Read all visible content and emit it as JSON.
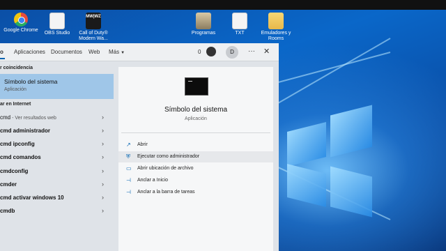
{
  "desktop": {
    "icons": [
      {
        "label": "Google Chrome",
        "icon": "chrome-icon"
      },
      {
        "label": "OBS Studio",
        "icon": "document-icon"
      },
      {
        "label": "Call of Duty®",
        "label2": "Modern Wa...",
        "icon": "game-icon",
        "badge": "MW|WZ"
      },
      {
        "label": "Programas",
        "icon": "folder-icon"
      },
      {
        "label": "TXT",
        "icon": "document-icon"
      },
      {
        "label": "Emuladores y",
        "label2": "Rooms",
        "icon": "folder-icon"
      }
    ]
  },
  "search": {
    "tabs": [
      {
        "label": "o",
        "active": true
      },
      {
        "label": "Aplicaciones"
      },
      {
        "label": "Documentos"
      },
      {
        "label": "Web"
      },
      {
        "label": "Más"
      }
    ],
    "points": "0",
    "avatar_initial": "D",
    "more_label": "···",
    "close_label": "✕"
  },
  "results": {
    "best_match_header": "r coincidencia",
    "best_match": {
      "title": "Símbolo del sistema",
      "subtitle": "Aplicación"
    },
    "internet_header": "ar en Internet",
    "items": [
      {
        "bold": "cmd",
        "rest": " - Ver resultados web"
      },
      {
        "bold": "cmd administrador",
        "rest": ""
      },
      {
        "bold": "cmd ipconfig",
        "rest": ""
      },
      {
        "bold": "cmd comandos",
        "rest": ""
      },
      {
        "bold": "cmdconfig",
        "rest": ""
      },
      {
        "bold": "cmder",
        "rest": ""
      },
      {
        "bold": "cmd activar windows 10",
        "rest": ""
      },
      {
        "bold": "cmdb",
        "rest": ""
      }
    ]
  },
  "detail": {
    "title": "Símbolo del sistema",
    "subtitle": "Aplicación",
    "actions": [
      {
        "label": "Abrir",
        "icon": "open-icon",
        "glyph": "↗"
      },
      {
        "label": "Ejecutar como administrador",
        "icon": "shield-icon",
        "glyph": "⛨"
      },
      {
        "label": "Abrir ubicación de archivo",
        "icon": "folder-icon",
        "glyph": "▭"
      },
      {
        "label": "Anclar a Inicio",
        "icon": "pin-icon",
        "glyph": "⊣"
      },
      {
        "label": "Anclar a la barra de tareas",
        "icon": "pin-icon",
        "glyph": "⊣"
      }
    ]
  },
  "colors": {
    "selected": "#9fc6e8",
    "accent": "#0063b1",
    "wallpaper": "#0a67c9"
  }
}
